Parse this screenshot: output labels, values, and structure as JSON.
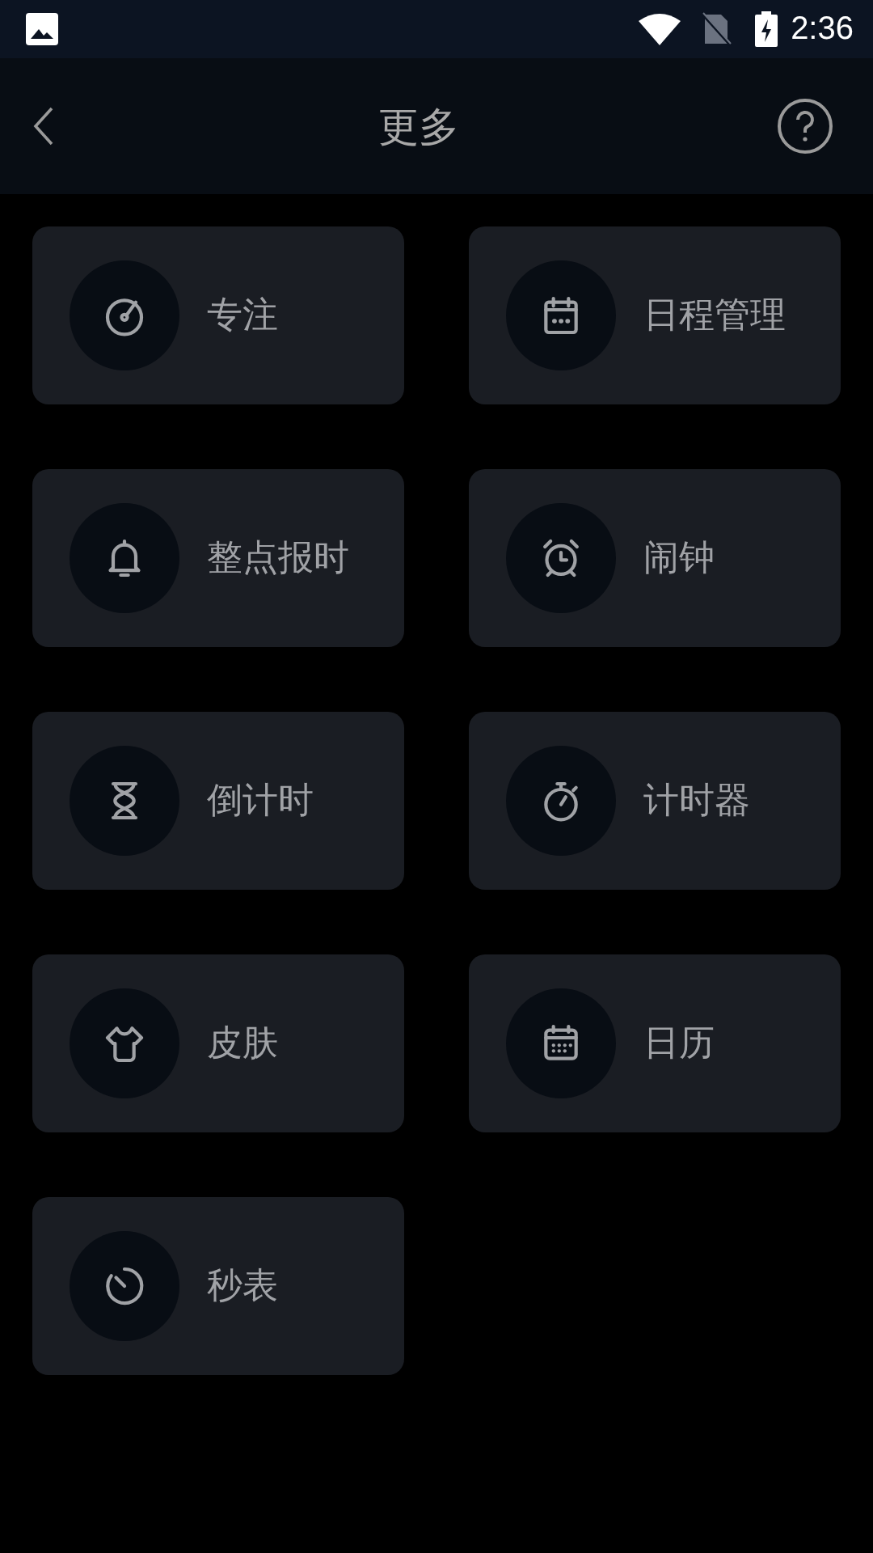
{
  "status_bar": {
    "time": "2:36"
  },
  "header": {
    "title": "更多"
  },
  "items": [
    {
      "label": "专注",
      "kind": "focus"
    },
    {
      "label": "日程管理",
      "kind": "schedule"
    },
    {
      "label": "整点报时",
      "kind": "bell"
    },
    {
      "label": "闹钟",
      "kind": "alarm"
    },
    {
      "label": "倒计时",
      "kind": "hourglass"
    },
    {
      "label": "计时器",
      "kind": "timer"
    },
    {
      "label": "皮肤",
      "kind": "shirt"
    },
    {
      "label": "日历",
      "kind": "calendar"
    },
    {
      "label": "秒表",
      "kind": "stopwatch"
    }
  ]
}
